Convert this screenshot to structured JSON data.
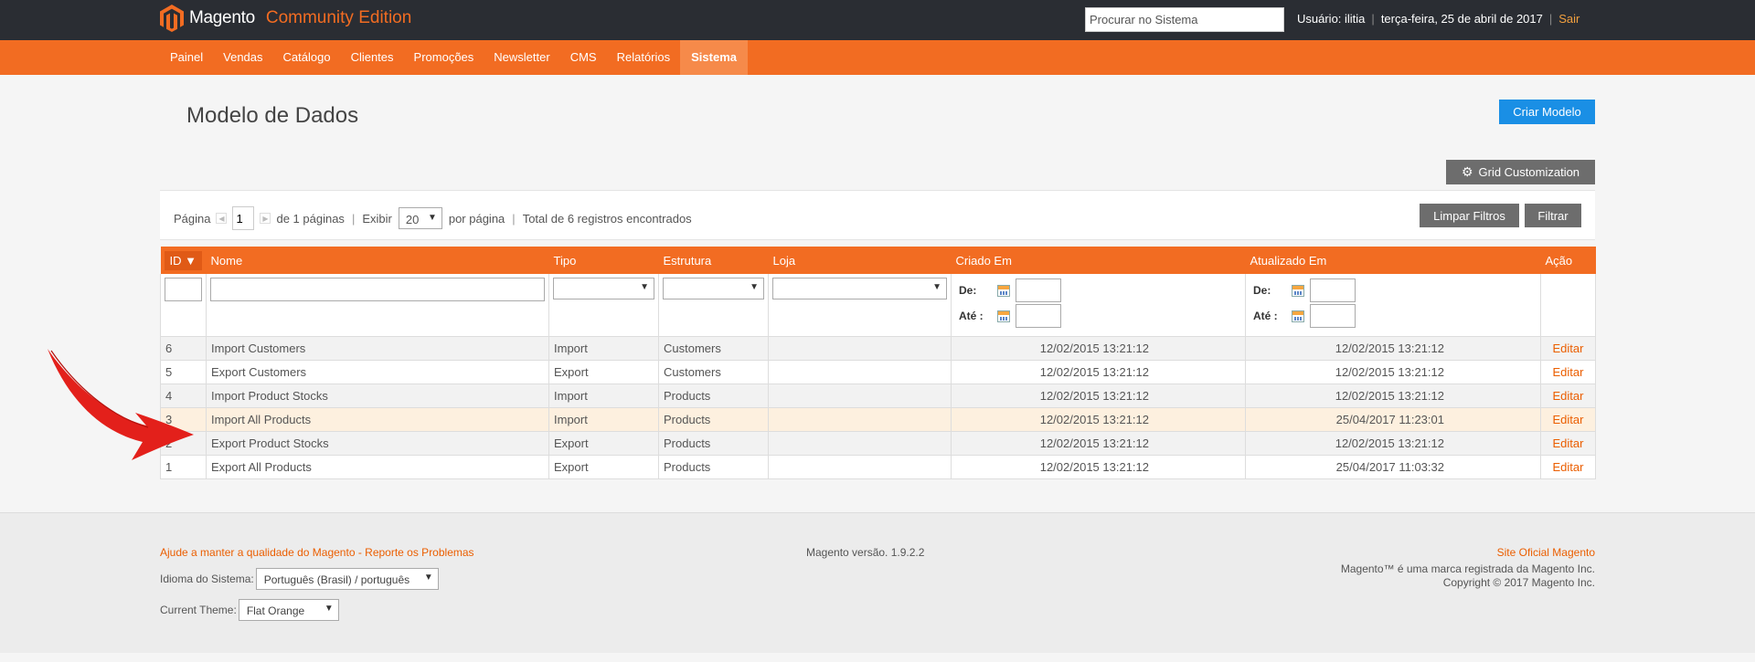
{
  "header": {
    "brand": "Magento",
    "edition": "Community Edition",
    "search_placeholder": "Procurar no Sistema",
    "user_label": "Usuário: ilitia",
    "date": "terça-feira, 25 de abril de 2017",
    "logout": "Sair"
  },
  "nav": [
    "Painel",
    "Vendas",
    "Catálogo",
    "Clientes",
    "Promoções",
    "Newsletter",
    "CMS",
    "Relatórios",
    "Sistema"
  ],
  "page": {
    "title": "Modelo de Dados",
    "create_button": "Criar Modelo",
    "grid_customization": "Grid Customization"
  },
  "pager": {
    "page_label": "Página",
    "page_value": "1",
    "of_pages": "de 1 páginas",
    "show_label": "Exibir",
    "limit": "20",
    "per_page": "por página",
    "total": "Total de 6 registros encontrados",
    "reset_button": "Limpar Filtros",
    "filter_button": "Filtrar"
  },
  "grid": {
    "columns": [
      "ID",
      "Nome",
      "Tipo",
      "Estrutura",
      "Loja",
      "Criado Em",
      "Atualizado Em",
      "Ação"
    ],
    "filter_from": "De:",
    "filter_to": "Até :",
    "rows": [
      {
        "id": "6",
        "name": "Import Customers",
        "type": "Import",
        "entity": "Customers",
        "store": "",
        "created": "12/02/2015 13:21:12",
        "updated": "12/02/2015 13:21:12",
        "action": "Editar"
      },
      {
        "id": "5",
        "name": "Export Customers",
        "type": "Export",
        "entity": "Customers",
        "store": "",
        "created": "12/02/2015 13:21:12",
        "updated": "12/02/2015 13:21:12",
        "action": "Editar"
      },
      {
        "id": "4",
        "name": "Import Product Stocks",
        "type": "Import",
        "entity": "Products",
        "store": "",
        "created": "12/02/2015 13:21:12",
        "updated": "12/02/2015 13:21:12",
        "action": "Editar"
      },
      {
        "id": "3",
        "name": "Import All Products",
        "type": "Import",
        "entity": "Products",
        "store": "",
        "created": "12/02/2015 13:21:12",
        "updated": "25/04/2017 11:23:01",
        "action": "Editar"
      },
      {
        "id": "2",
        "name": "Export Product Stocks",
        "type": "Export",
        "entity": "Products",
        "store": "",
        "created": "12/02/2015 13:21:12",
        "updated": "12/02/2015 13:21:12",
        "action": "Editar"
      },
      {
        "id": "1",
        "name": "Export All Products",
        "type": "Export",
        "entity": "Products",
        "store": "",
        "created": "12/02/2015 13:21:12",
        "updated": "25/04/2017 11:03:32",
        "action": "Editar"
      }
    ]
  },
  "footer": {
    "help_link": "Ajude a manter a qualidade do Magento - Reporte os Problemas",
    "locale_label": "Idioma do Sistema:",
    "locale_value": "Português (Brasil) / português",
    "theme_label": "Current Theme:",
    "theme_value": "Flat Orange",
    "version": "Magento versão. 1.9.2.2",
    "official_site": "Site Oficial Magento",
    "trademark": "Magento™ é uma marca registrada da Magento Inc.",
    "copyright": "Copyright © 2017 Magento Inc."
  },
  "colors": {
    "header_bg": "#2a2d33",
    "brand_orange": "#f26c22",
    "primary_blue": "#1a8fe5",
    "button_gray": "#6d6d6d",
    "link_orange": "#eb5e00",
    "highlight_row": "#fdf0df",
    "annotation_arrow": "#e3201b"
  },
  "icons": [
    "magento-logo-icon",
    "gear-icon",
    "calendar-icon",
    "chevron-down-icon",
    "sort-desc-icon",
    "annotation-arrow-icon"
  ]
}
